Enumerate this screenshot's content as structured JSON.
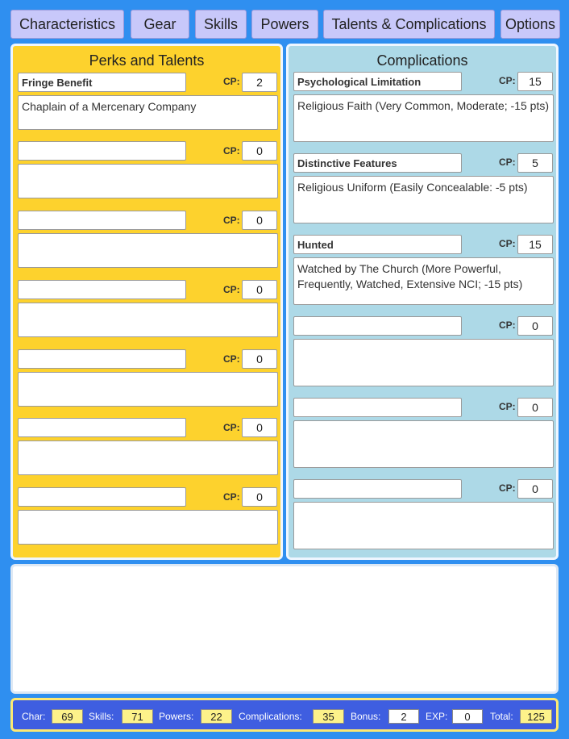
{
  "tabs": [
    {
      "label": "Characteristics"
    },
    {
      "label": "Gear"
    },
    {
      "label": "Skills"
    },
    {
      "label": "Powers"
    },
    {
      "label": "Talents & Complications"
    },
    {
      "label": "Options"
    }
  ],
  "perks": {
    "title": "Perks and Talents",
    "cp_label": "CP:",
    "items": [
      {
        "name": "Fringe Benefit",
        "cp": "2",
        "description": "Chaplain of a Mercenary Company"
      },
      {
        "name": "",
        "cp": "0",
        "description": ""
      },
      {
        "name": "",
        "cp": "0",
        "description": ""
      },
      {
        "name": "",
        "cp": "0",
        "description": ""
      },
      {
        "name": "",
        "cp": "0",
        "description": ""
      },
      {
        "name": "",
        "cp": "0",
        "description": ""
      },
      {
        "name": "",
        "cp": "0",
        "description": ""
      }
    ]
  },
  "complications": {
    "title": "Complications",
    "cp_label": "CP:",
    "items": [
      {
        "name": "Psychological Limitation",
        "cp": "15",
        "description": "Religious Faith (Very Common, Moderate; -15 pts)"
      },
      {
        "name": "Distinctive Features",
        "cp": "5",
        "description": "Religious Uniform (Easily Concealable: -5 pts)"
      },
      {
        "name": "Hunted",
        "cp": "15",
        "description": "Watched by The Church (More Powerful, Frequently, Watched, Extensive NCI; -15 pts)"
      },
      {
        "name": "",
        "cp": "0",
        "description": ""
      },
      {
        "name": "",
        "cp": "0",
        "description": ""
      },
      {
        "name": "",
        "cp": "0",
        "description": ""
      }
    ]
  },
  "notes": {
    "value": ""
  },
  "totals": {
    "char_label": "Char:",
    "char": "69",
    "skills_label": "Skills:",
    "skills": "71",
    "powers_label": "Powers:",
    "powers": "22",
    "complications_label": "Complications:",
    "complications": "35",
    "bonus_label": "Bonus:",
    "bonus": "2",
    "exp_label": "EXP:",
    "exp": "0",
    "total_label": "Total:",
    "total": "125"
  },
  "colors": {
    "background": "#2f8ff0",
    "tab": "#c8c8fa",
    "perks_panel": "#fdd22d",
    "complications_panel": "#add9e7",
    "bottom_bar": "#3f5ee0",
    "highlight_value": "#fdf28a"
  }
}
